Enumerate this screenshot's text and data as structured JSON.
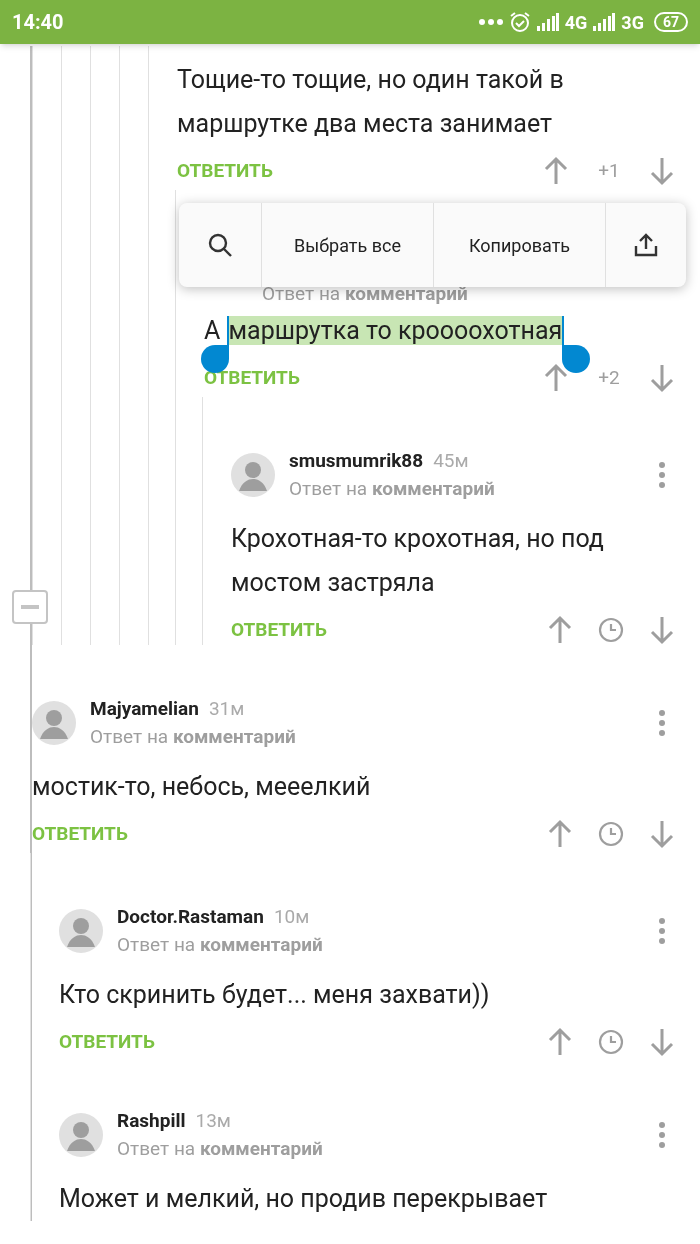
{
  "status_bar": {
    "time": "14:40",
    "network_1": "4G",
    "network_2": "3G",
    "battery": "67"
  },
  "selection_toolbar": {
    "actions": [
      {
        "kind": "search"
      },
      {
        "kind": "text",
        "label": "Выбрать все"
      },
      {
        "kind": "text",
        "label": "Копировать"
      },
      {
        "kind": "share"
      }
    ]
  },
  "thread": {
    "collapsed": false,
    "children": [
      {
        "children": [
          {
            "children": [
              {
                "children": [
                  {
                    "children": [
                      {
                        "children": [
                          {
                            "text": "Тощие-то тощие, но один такой в маршрутке два места занимает",
                            "reply_label": "ОТВЕТИТЬ",
                            "rating": {
                              "kind": "score",
                              "value": "+1"
                            },
                            "children": [
                              {
                                "reply_to": "Ответ на **комментарий**",
                                "text": "А",
                                "selected_text": "маршрутка то кроооохотная",
                                "reply_label": "ОТВЕТИТЬ",
                                "rating": {
                                  "kind": "score",
                                  "value": "+2"
                                },
                                "children": [
                                  {
                                    "author": "smusmumrik88",
                                    "time": "45м",
                                    "reply_to": "Ответ на **комментарий**",
                                    "text": "Крохотная-то крохотная, но под мостом застряла",
                                    "reply_label": "ОТВЕТИТЬ",
                                    "rating": {
                                      "kind": "clock"
                                    }
                                  }
                                ]
                              }
                            ]
                          }
                        ]
                      }
                    ]
                  }
                ]
              }
            ]
          }
        ]
      },
      {
        "author": "Majyamelian",
        "time": "31м",
        "reply_to": "Ответ на **комментарий**",
        "text": "мостик-то, небось, мееелкий",
        "reply_label": "ОТВЕТИТЬ",
        "rating": {
          "kind": "clock"
        },
        "children": [
          {
            "author": "Doctor.Rastaman",
            "time": "10м",
            "reply_to": "Ответ на **комментарий**",
            "text": "Кто скринить будет... меня захвати))",
            "reply_label": "ОТВЕТИТЬ",
            "rating": {
              "kind": "clock"
            }
          },
          {
            "author": "Rashpill",
            "time": "13м",
            "reply_to": "Ответ на **комментарий**",
            "text": "Может и мелкий, но продив перекрывает"
          }
        ]
      }
    ]
  }
}
